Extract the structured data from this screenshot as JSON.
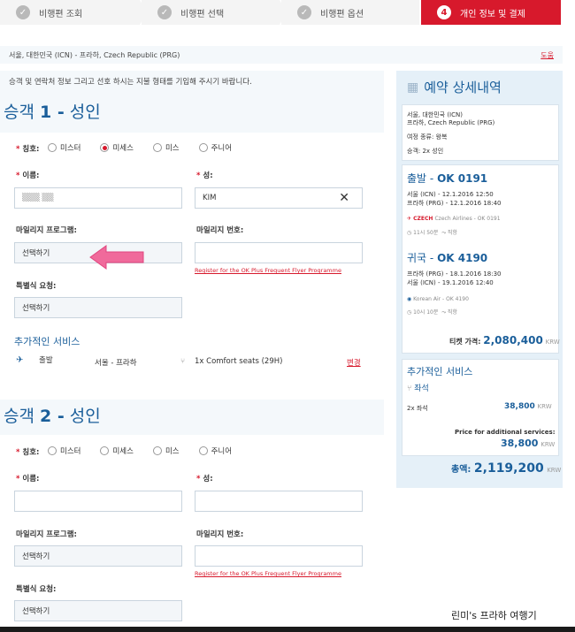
{
  "steps": [
    {
      "label": "비행편 조회",
      "state": "done"
    },
    {
      "label": "비행편 선택",
      "state": "done"
    },
    {
      "label": "비행편 옵션",
      "state": "done"
    },
    {
      "label": "개인 정보 및 결제",
      "number": "4",
      "state": "active"
    }
  ],
  "route": {
    "text": "서울, 대한민국 (ICN) - 프라하, Czech Republic (PRG)",
    "link": "도움"
  },
  "form": {
    "instruction": "승객 및 연락처 정보 그리고 선호 하시는 지불 형태를 기입해 주시기 바랍니다.",
    "pax1": {
      "title_prefix": "승객",
      "number": "1 -",
      "title_suffix": "성인",
      "title_label": "칭호:",
      "titles": [
        "미스터",
        "미세스",
        "미스",
        "주니어"
      ],
      "selected_title": "미세스",
      "first_name_label": "이름:",
      "first_name_value": "▒▒▒  ▒▒",
      "last_name_label": "성:",
      "last_name_value": "KIM",
      "mileage_program_label": "마일리지 프로그램:",
      "mileage_program_value": "선택하기",
      "mileage_number_label": "마일리지 번호:",
      "mileage_number_value": "",
      "ok_plus_link": "Register for the OK Plus Frequent Flyer Programme",
      "special_meal_label": "특별식 요청:",
      "special_meal_value": "선택하기",
      "extra_services_title": "추가적인 서비스",
      "service": {
        "direction": "출발",
        "route": "서울 - 프라하",
        "item": "1x Comfort seats (29H)",
        "change": "변경"
      }
    },
    "pax2": {
      "title_prefix": "승객",
      "number": "2 -",
      "title_suffix": "성인",
      "title_label": "칭호:",
      "titles": [
        "미스터",
        "미세스",
        "미스",
        "주니어"
      ],
      "first_name_label": "이름:",
      "first_name_value": "",
      "last_name_label": "성:",
      "last_name_value": "",
      "mileage_program_label": "마일리지 프로그램:",
      "mileage_program_value": "선택하기",
      "mileage_number_label": "마일리지 번호:",
      "mileage_number_value": "",
      "ok_plus_link": "Register for the OK Plus Frequent Flyer Programme",
      "special_meal_label": "특별식 요청:",
      "special_meal_value": "선택하기"
    }
  },
  "sidebar": {
    "title": "예약 상세내역",
    "summary": {
      "line1": "서울, 대한민국 (ICN)",
      "line2": "프라하, Czech Republic (PRG)",
      "trip_type": "여정 종류: 왕복",
      "passengers": "승객: 2x 성인"
    },
    "outbound": {
      "heading": "출발",
      "flight": "OK 0191",
      "dep": "서울 (ICN) - 12.1.2016 12:50",
      "arr": "프라하 (PRG) - 12.1.2016 18:40",
      "airline": "Czech Airlines - OK 0191",
      "duration": "11시 50분",
      "stops": "직항"
    },
    "inbound": {
      "heading": "귀국",
      "flight": "OK 4190",
      "dep": "프라하 (PRG) - 18.1.2016 18:30",
      "arr": "서울 (ICN) - 19.1.2016 12:40",
      "airline": "Korean Air - OK 4190",
      "duration": "10시 10분",
      "stops": "직항"
    },
    "ticket_price_label": "티켓 가격:",
    "ticket_price": "2,080,400",
    "currency": "KRW",
    "services_title": "추가적인 서비스",
    "seat_label": "좌석",
    "seat_count": "2x 좌석",
    "seat_price": "38,800",
    "additional_label": "Price for additional services:",
    "additional_price": "38,800",
    "total_label": "총액:",
    "total_price": "2,119,200"
  },
  "watermark": "린미's 프라하 여행기",
  "colors": {
    "accent": "#d7192c",
    "brand_blue": "#1a5e9a",
    "panel_bg": "#f4f8fb",
    "sidebar_bg": "#e5f0f8",
    "annotation_arrow": "#f06a9b"
  }
}
